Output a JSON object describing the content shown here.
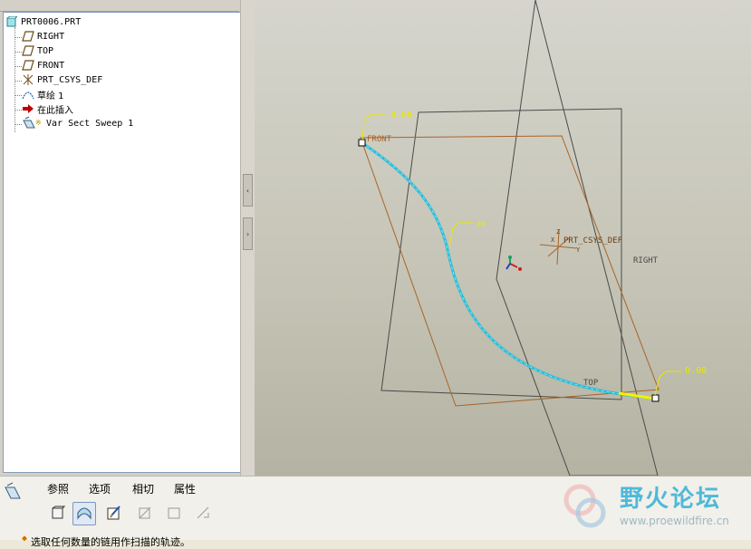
{
  "model_tree": {
    "items": [
      {
        "label": "PRT0006.PRT",
        "icon": "part-icon"
      },
      {
        "label": "RIGHT",
        "icon": "datum-plane-icon"
      },
      {
        "label": "TOP",
        "icon": "datum-plane-icon"
      },
      {
        "label": "FRONT",
        "icon": "datum-plane-icon"
      },
      {
        "label": "PRT_CSYS_DEF",
        "icon": "coordinate-system-icon"
      },
      {
        "label": "草绘 1",
        "icon": "sketch-icon"
      },
      {
        "label": "在此插入",
        "icon": "insert-here-arrow-icon"
      },
      {
        "label": "Var Sect Sweep 1",
        "icon": "var-sect-sweep-icon"
      }
    ]
  },
  "graphics": {
    "plane_labels": {
      "front": "FRONT",
      "right": "RIGHT",
      "top": "TOP"
    },
    "csys_label": "PRT_CSYS_DEF",
    "csys_axes": {
      "x": "X",
      "y": "Y",
      "z": "Z"
    },
    "start_value": "0.00",
    "end_value": "0.00",
    "mid_marker": "##",
    "colors": {
      "trajectory": "#29bfd9",
      "plane_front": "#a8642a",
      "plane_other": "#4a4a4a",
      "dimension": "#e8e800"
    }
  },
  "dashboard": {
    "tabs": [
      "参照",
      "选项",
      "相切",
      "属性"
    ],
    "tools": [
      "solid-icon",
      "surface-icon",
      "sketch-section-icon",
      "remove-material-icon",
      "thicken-icon",
      "no-tool-icon"
    ],
    "status_text": "选取任何数量的链用作扫描的轨迹。"
  },
  "watermark": {
    "title": "野火论坛",
    "url": "www.proewildfire.cn"
  }
}
